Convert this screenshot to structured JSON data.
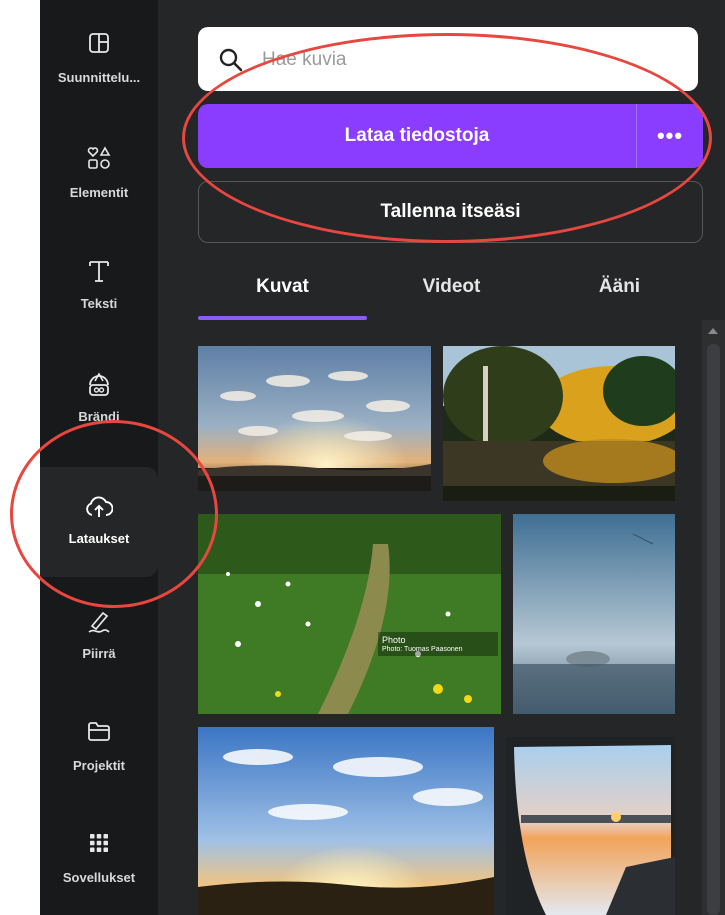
{
  "sidebar": {
    "items": [
      {
        "label": "Suunnittelu...",
        "icon": "layout-icon"
      },
      {
        "label": "Elementit",
        "icon": "shapes-icon"
      },
      {
        "label": "Teksti",
        "icon": "text-icon"
      },
      {
        "label": "Brändi",
        "icon": "brand-icon"
      },
      {
        "label": "Lataukset",
        "icon": "cloud-upload-icon",
        "active": true
      },
      {
        "label": "Piirrä",
        "icon": "draw-icon"
      },
      {
        "label": "Projektit",
        "icon": "folder-icon"
      },
      {
        "label": "Sovellukset",
        "icon": "apps-grid-icon"
      }
    ]
  },
  "search": {
    "placeholder": "Hae kuvia",
    "value": ""
  },
  "upload_button": {
    "label": "Lataa tiedostoja",
    "more_label": "•••"
  },
  "record_button": {
    "label": "Tallenna itseäsi"
  },
  "tabs": [
    {
      "label": "Kuvat",
      "active": true
    },
    {
      "label": "Videot"
    },
    {
      "label": "Ääni"
    }
  ],
  "gallery": {
    "images": [
      {
        "subject": "sunset sky with sunrays over field"
      },
      {
        "subject": "autumn trees reflected in river"
      },
      {
        "subject": "green meadow path with wildflowers",
        "overlay_title": "Photo",
        "overlay_caption": "Photo: Tuomas Paasonen"
      },
      {
        "subject": "misty field at dawn"
      },
      {
        "subject": "summer sunset with clouds over grass"
      },
      {
        "subject": "snowy landscape through car window"
      }
    ]
  },
  "colors": {
    "accent": "#8b3dff",
    "annotation": "#e8473f",
    "panel": "#252627",
    "sidebar": "#18191b"
  }
}
